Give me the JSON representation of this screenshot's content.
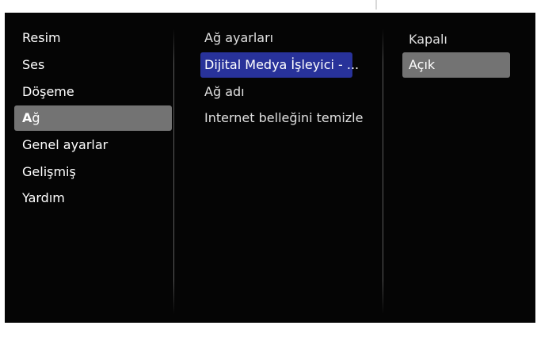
{
  "menu": {
    "items": [
      {
        "label": "Resim"
      },
      {
        "label": "Ses"
      },
      {
        "label": "Döşeme"
      },
      {
        "label_bold": "A",
        "label_rest": "ğ"
      },
      {
        "label": "Genel ayarlar"
      },
      {
        "label": "Gelişmiş"
      },
      {
        "label": "Yardım"
      }
    ]
  },
  "submenu": {
    "items": [
      {
        "label": "Ağ ayarları"
      },
      {
        "label": "Dijital Medya İşleyici - ..."
      },
      {
        "label": "Ağ adı"
      },
      {
        "label": "Internet belleğini temizle"
      }
    ]
  },
  "options": {
    "items": [
      {
        "label": "Kapalı"
      },
      {
        "label": "Açık"
      }
    ]
  },
  "colors": {
    "background": "#050505",
    "selected_highlight": "#737373",
    "focus_highlight": "#28329a",
    "text": "#ffffff"
  }
}
